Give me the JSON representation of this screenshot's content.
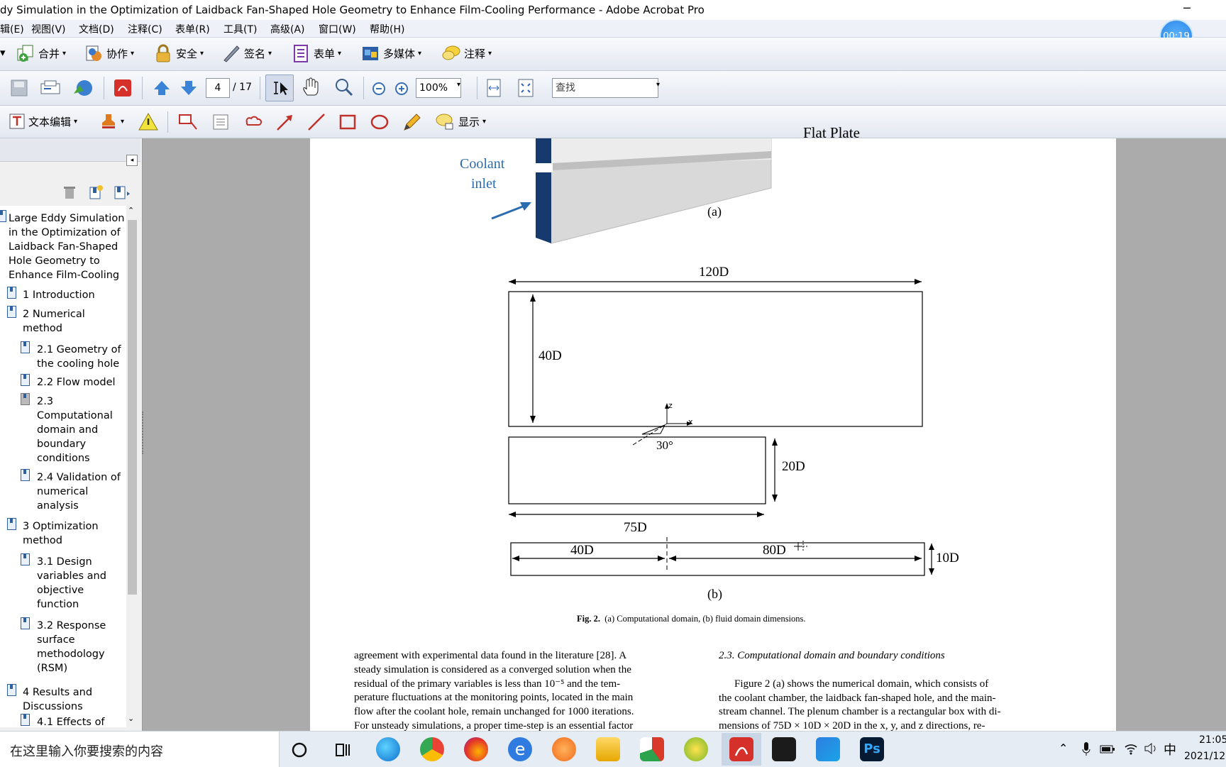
{
  "window": {
    "title": "dy Simulation in the Optimization of Laidback Fan-Shaped Hole Geometry to Enhance Film-Cooling Performance - Adobe Acrobat Pro",
    "timer": "00:19"
  },
  "menu": [
    "辑(E)",
    "视图(V)",
    "文档(D)",
    "注释(C)",
    "表单(R)",
    "工具(T)",
    "高级(A)",
    "窗口(W)",
    "帮助(H)"
  ],
  "toolbar1": {
    "merge": "合并",
    "collaborate": "协作",
    "security": "安全",
    "sign": "签名",
    "forms": "表单",
    "multimedia": "多媒体",
    "comment": "注释"
  },
  "toolbar2": {
    "page_current": "4",
    "page_total": "/ 17",
    "zoom": "100%",
    "find_placeholder": "查找"
  },
  "toolbar3": {
    "text_edit": "文本编辑",
    "show": "显示"
  },
  "bookmarks": [
    {
      "label": "Large Eddy Simulation in the Optimization of Laidback Fan-Shaped Hole Geometry to Enhance Film-Cooling",
      "level": 0
    },
    {
      "label": "1 Introduction",
      "level": 1
    },
    {
      "label": "2 Numerical method",
      "level": 1
    },
    {
      "label": "2.1 Geometry of the cooling hole",
      "level": 2
    },
    {
      "label": "2.2 Flow model",
      "level": 2
    },
    {
      "label": "2.3 Computational domain and boundary conditions",
      "level": 2
    },
    {
      "label": "2.4 Validation of numerical analysis",
      "level": 2
    },
    {
      "label": "3 Optimization method",
      "level": 1
    },
    {
      "label": "3.1 Design variables and objective function",
      "level": 2
    },
    {
      "label": "3.2 Response surface methodology (RSM)",
      "level": 2
    },
    {
      "label": "4 Results and Discussions",
      "level": 1
    },
    {
      "label": "4.1 Effects of",
      "level": 2
    }
  ],
  "figure": {
    "flat_plate": "Flat Plate",
    "coolant_inlet_1": "Coolant",
    "coolant_inlet_2": "inlet",
    "label_a": "(a)",
    "label_b": "(b)",
    "dim_120": "120D",
    "dim_40": "40D",
    "dim_20": "20D",
    "dim_75": "75D",
    "dim_40b": "40D",
    "dim_80": "80D",
    "dim_10": "10D",
    "angle": "30°",
    "axis_z": "z",
    "axis_x": "x",
    "caption_bold": "Fig. 2.",
    "caption_text": "(a) Computational domain, (b) fluid domain dimensions."
  },
  "body_left": [
    "agreement with experimental data found in the literature [28]. A",
    "steady simulation is considered as a converged solution when the",
    "residual of the primary variables is less than 10⁻⁵ and the tem-",
    "perature fluctuations at the monitoring points, located in the main",
    "flow after the coolant hole, remain unchanged for 1000 iterations.",
    "For unsteady simulations, a proper time-step is an essential factor"
  ],
  "body_right": {
    "heading": "2.3. Computational domain and boundary conditions",
    "lines": [
      "Figure 2 (a) shows the numerical domain, which consists of",
      "the coolant chamber, the laidback fan-shaped hole, and the main-",
      "stream channel. The plenum chamber is a rectangular box with di-",
      "mensions of 75D × 10D × 20D in the x, y, and z directions, re-"
    ]
  },
  "taskbar": {
    "search_placeholder": "在这里输入你要搜索的内容",
    "ime": "中",
    "time": "21:05",
    "date": "2021/12"
  }
}
